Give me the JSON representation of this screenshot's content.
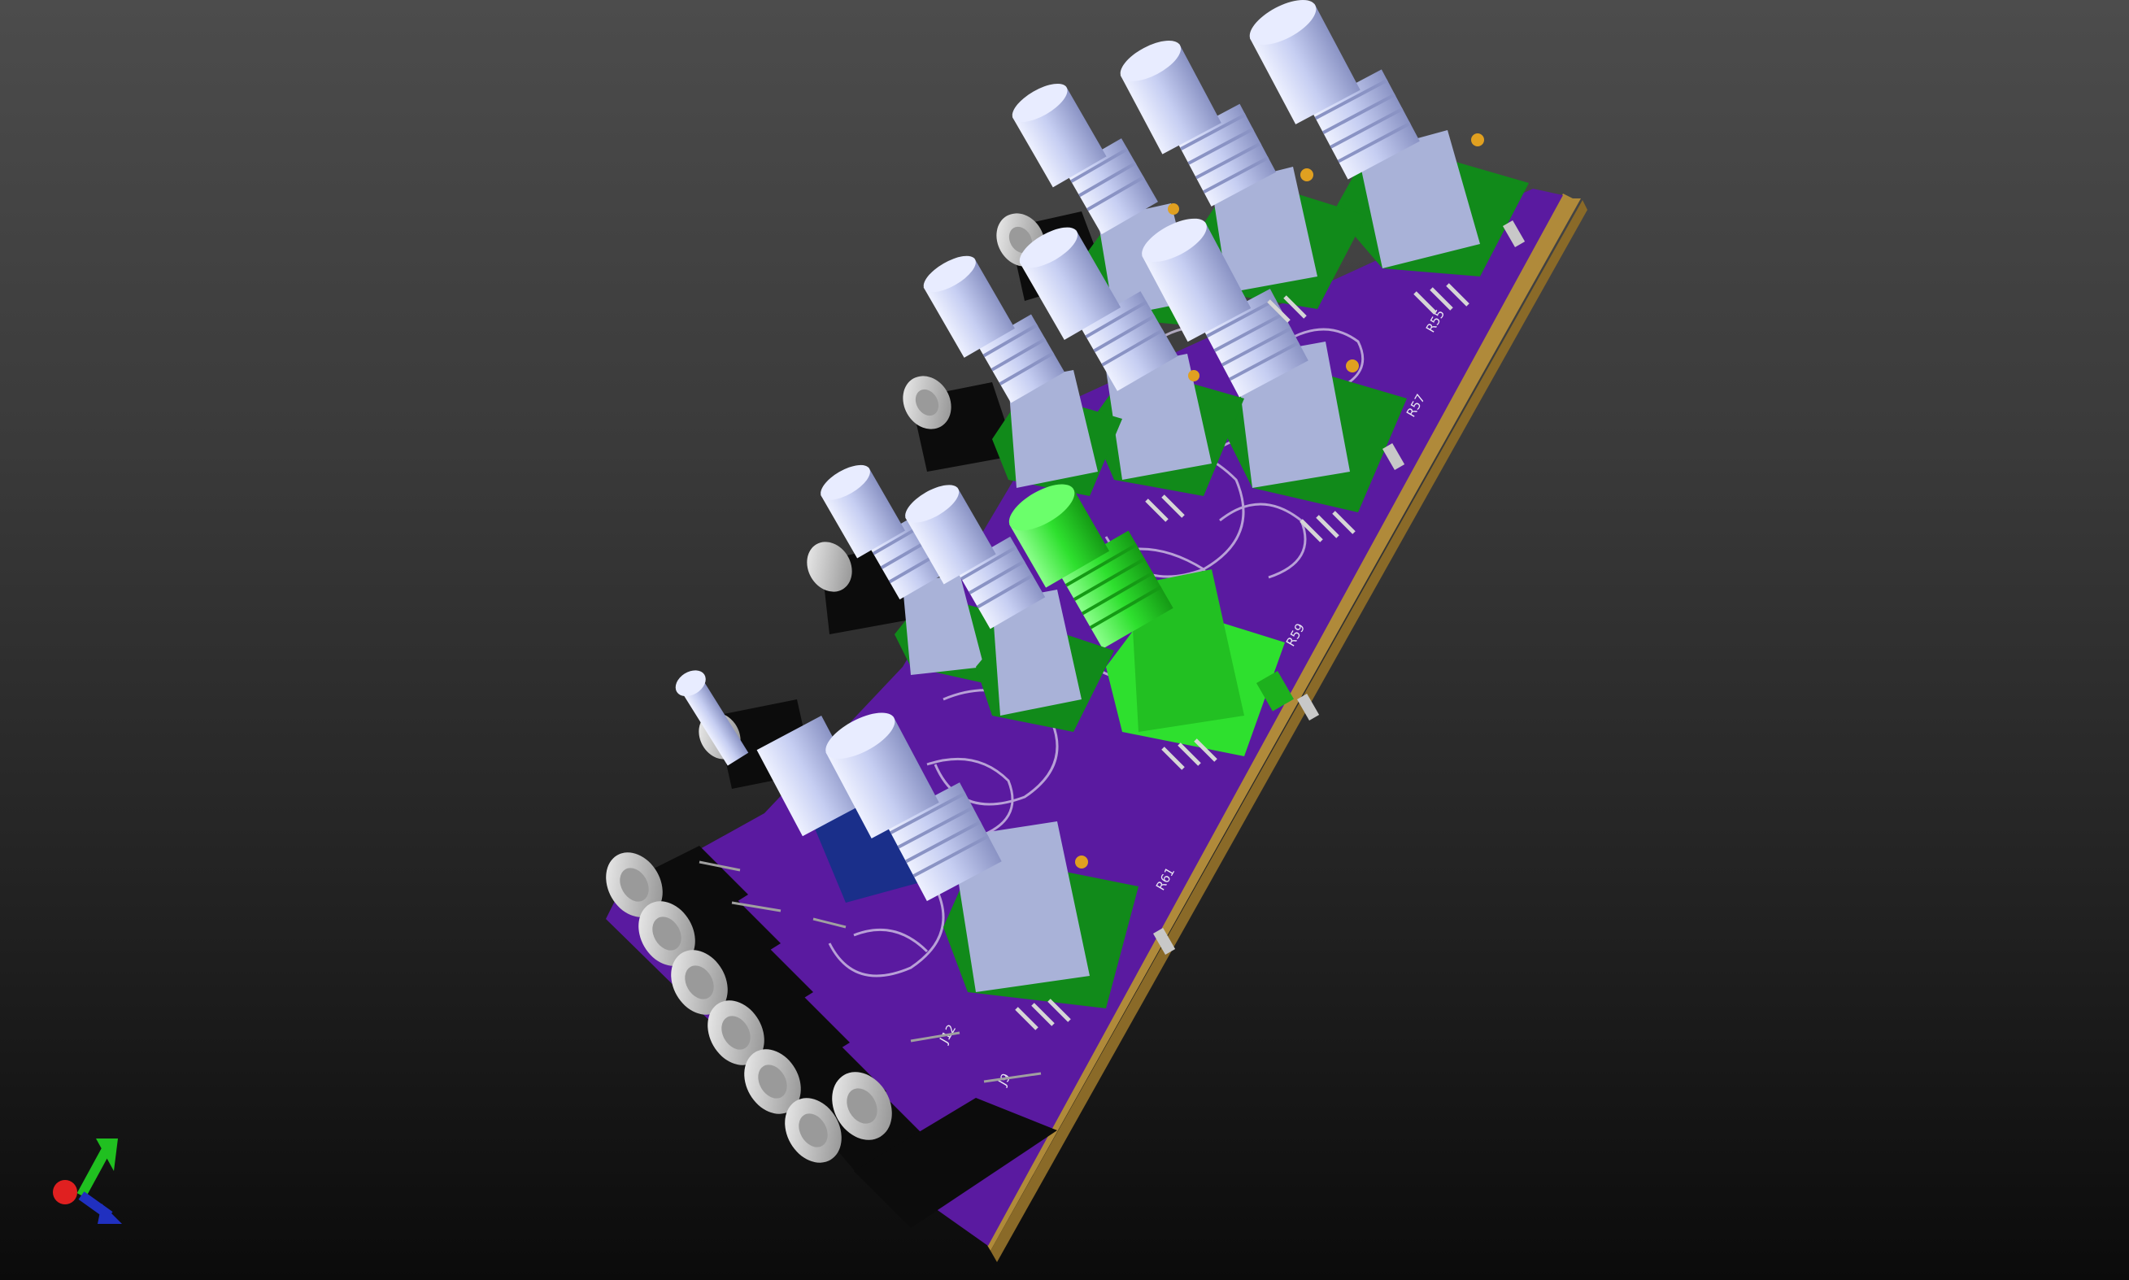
{
  "viewer": {
    "background_top": "#4c4c4c",
    "background_bottom": "#0b0b0b"
  },
  "pcb": {
    "soldermask_color": "#5a1aa0",
    "edge_color": "#b08a3a",
    "silkscreen_color": "#e8e4f2",
    "labels": {
      "r55": "R55",
      "r57": "R57",
      "r59": "R59",
      "r61": "R61",
      "j12": "J12",
      "j9": "J9"
    }
  },
  "components": {
    "knob_color": "#c6cef2",
    "pot_body_color": "#118a1a",
    "green_pot_color": "#2ee02e",
    "jack_body_color": "#0c0c0c",
    "jack_nut_color": "#c8c8c8",
    "toggle_base_color": "#1a2f8a"
  },
  "axes": {
    "x_color": "#e02020",
    "y_color": "#20c020",
    "z_color": "#2030c0"
  }
}
